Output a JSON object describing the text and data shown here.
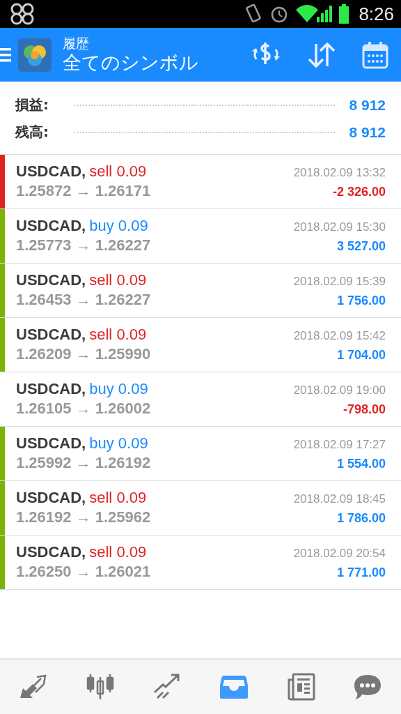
{
  "status_bar": {
    "time": "8:26"
  },
  "header": {
    "subtitle": "履歴",
    "title": "全てのシンボル"
  },
  "summary": [
    {
      "label": "損益:",
      "value": "8 912"
    },
    {
      "label": "残高:",
      "value": "8 912"
    }
  ],
  "trades": [
    {
      "symbol": "USDCAD,",
      "side": "sell",
      "volume": "0.09",
      "prices": "1.25872 → 1.26171",
      "time": "2018.02.09 13:32",
      "profit": "-2 326.00",
      "negative": true,
      "color": "#e02424"
    },
    {
      "symbol": "USDCAD,",
      "side": "buy",
      "volume": "0.09",
      "prices": "1.25773 → 1.26227",
      "time": "2018.02.09 15:30",
      "profit": "3 527.00",
      "negative": false,
      "color": "#7cb305"
    },
    {
      "symbol": "USDCAD,",
      "side": "sell",
      "volume": "0.09",
      "prices": "1.26453 → 1.26227",
      "time": "2018.02.09 15:39",
      "profit": "1 756.00",
      "negative": false,
      "color": "#7cb305"
    },
    {
      "symbol": "USDCAD,",
      "side": "sell",
      "volume": "0.09",
      "prices": "1.26209 → 1.25990",
      "time": "2018.02.09 15:42",
      "profit": "1 704.00",
      "negative": false,
      "color": "#7cb305"
    },
    {
      "symbol": "USDCAD,",
      "side": "buy",
      "volume": "0.09",
      "prices": "1.26105 → 1.26002",
      "time": "2018.02.09 19:00",
      "profit": "-798.00",
      "negative": true
    },
    {
      "symbol": "USDCAD,",
      "side": "buy",
      "volume": "0.09",
      "prices": "1.25992 → 1.26192",
      "time": "2018.02.09 17:27",
      "profit": "1 554.00",
      "negative": false,
      "color": "#7cb305"
    },
    {
      "symbol": "USDCAD,",
      "side": "sell",
      "volume": "0.09",
      "prices": "1.26192 → 1.25962",
      "time": "2018.02.09 18:45",
      "profit": "1 786.00",
      "negative": false,
      "color": "#7cb305"
    },
    {
      "symbol": "USDCAD,",
      "side": "sell",
      "volume": "0.09",
      "prices": "1.26250 → 1.26021",
      "time": "2018.02.09 20:54",
      "profit": "1 771.00",
      "negative": false,
      "color": "#7cb305"
    }
  ],
  "bottom_nav": [
    {
      "kind": "quotes",
      "selected": false
    },
    {
      "kind": "chart",
      "selected": false
    },
    {
      "kind": "trade",
      "selected": false
    },
    {
      "kind": "history",
      "selected": true
    },
    {
      "kind": "news",
      "selected": false
    },
    {
      "kind": "chat",
      "selected": false
    }
  ]
}
